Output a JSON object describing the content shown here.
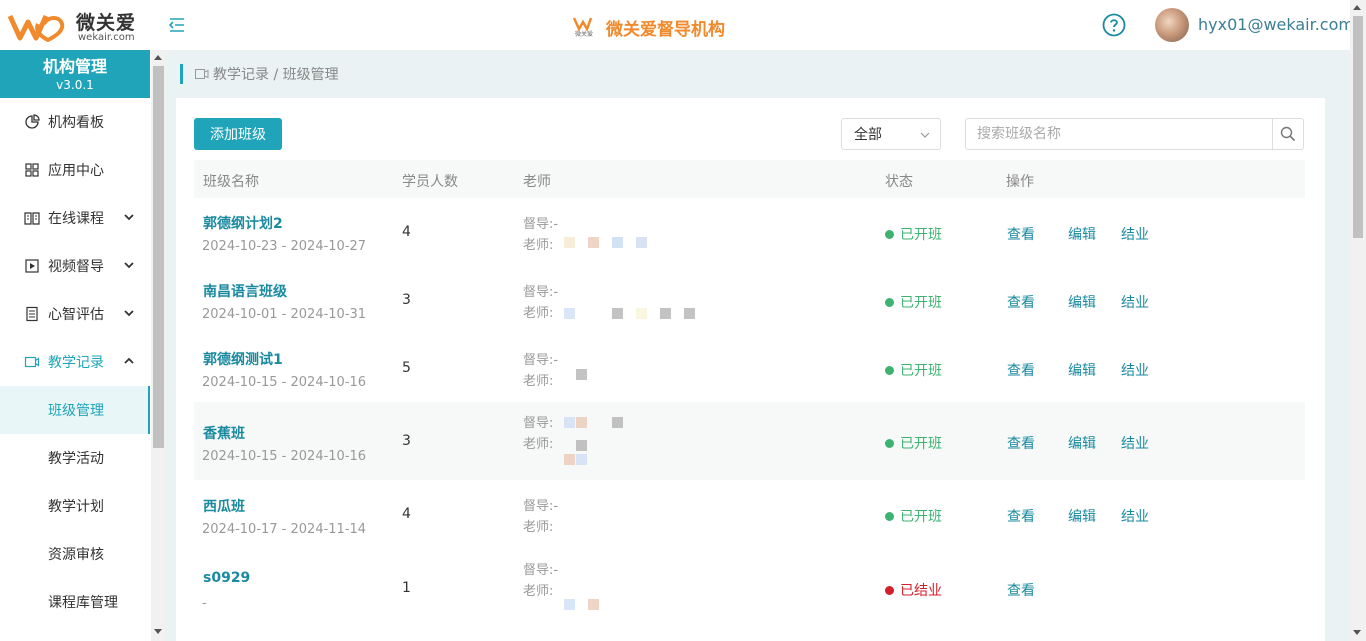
{
  "header": {
    "logo_text": "微关爱",
    "logo_sub": "wekair.com",
    "brand_title": "微关爱督导机构",
    "user_email": "hyx01@wekair.com"
  },
  "sidebar": {
    "title": "机构管理",
    "version": "v3.0.1",
    "items": [
      {
        "label": "机构看板",
        "icon": "pie-chart-icon"
      },
      {
        "label": "应用中心",
        "icon": "grid-icon"
      },
      {
        "label": "在线课程",
        "icon": "book-icon",
        "expandable": true
      },
      {
        "label": "视频督导",
        "icon": "play-icon",
        "expandable": true
      },
      {
        "label": "心智评估",
        "icon": "clipboard-icon",
        "expandable": true
      },
      {
        "label": "教学记录",
        "icon": "video-icon",
        "expanded": true
      }
    ],
    "sub_items": [
      {
        "label": "班级管理",
        "active": true
      },
      {
        "label": "教学活动"
      },
      {
        "label": "教学计划"
      },
      {
        "label": "资源审核"
      },
      {
        "label": "课程库管理"
      }
    ]
  },
  "breadcrumb": "教学记录 / 班级管理",
  "toolbar": {
    "add_label": "添加班级",
    "filter_value": "全部",
    "search_placeholder": "搜索班级名称"
  },
  "table": {
    "headers": [
      "班级名称",
      "学员人数",
      "老师",
      "状态",
      "操作"
    ],
    "rows": [
      {
        "name": "郭德纲计划2",
        "date": "2024-10-23 - 2024-10-27",
        "count": "4",
        "sup": "督导:-",
        "teacher": "老师:",
        "status": "已开班",
        "open": true
      },
      {
        "name": "南昌语言班级",
        "date": "2024-10-01 - 2024-10-31",
        "count": "3",
        "sup": "督导:-",
        "teacher": "老师:",
        "status": "已开班",
        "open": true
      },
      {
        "name": "郭德纲测试1",
        "date": "2024-10-15 - 2024-10-16",
        "count": "5",
        "sup": "督导:-",
        "teacher": "老师:",
        "status": "已开班",
        "open": true
      },
      {
        "name": "香蕉班",
        "date": "2024-10-15 - 2024-10-16",
        "count": "3",
        "sup": "督导:",
        "teacher": "老师:",
        "status": "已开班",
        "open": true
      },
      {
        "name": "西瓜班",
        "date": "2024-10-17 - 2024-11-14",
        "count": "4",
        "sup": "督导:-",
        "teacher": "老师:",
        "status": "已开班",
        "open": true
      },
      {
        "name": "s0929",
        "date": "-",
        "count": "1",
        "sup": "督导:-",
        "teacher": "老师:",
        "status": "已结业",
        "open": false
      }
    ],
    "actions": {
      "view": "查看",
      "edit": "编辑",
      "finish": "结业"
    }
  },
  "colors": {
    "accent": "#20a4b9",
    "brand": "#f08a2c",
    "open": "#3cb371",
    "closed": "#d0202a"
  }
}
